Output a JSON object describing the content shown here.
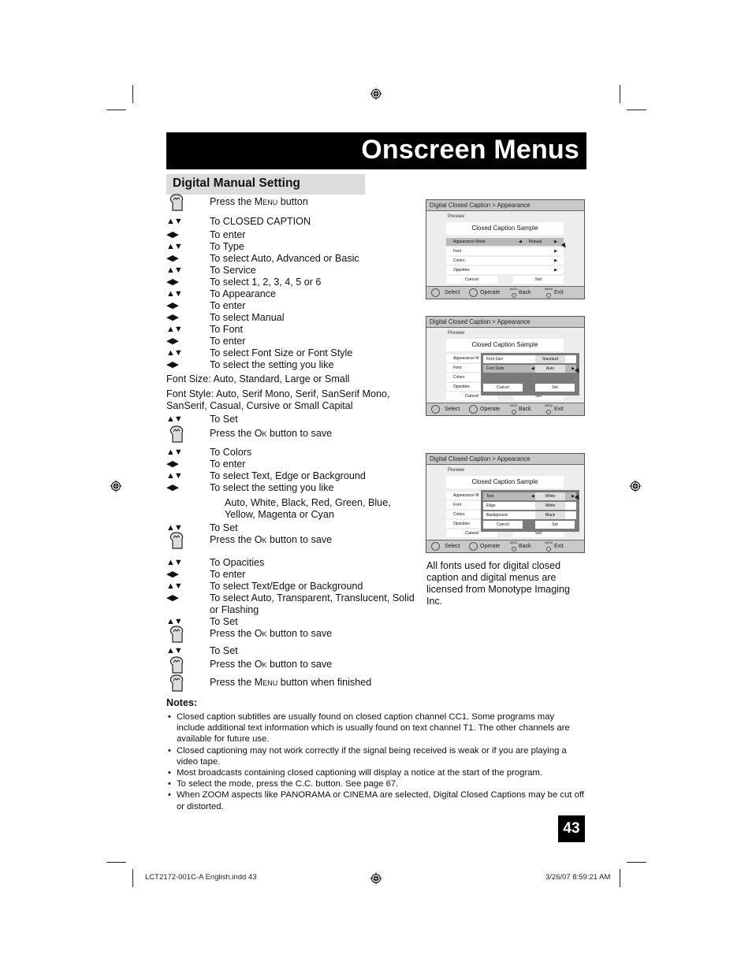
{
  "header": {
    "title": "Onscreen Menus"
  },
  "section": {
    "title": "Digital Manual Setting"
  },
  "steps": [
    {
      "icon": "hand-press-icon",
      "pre": "Press the ",
      "key": "Menu",
      "post": " button"
    },
    {
      "icon": "up-down-arrows",
      "text": "To CLOSED CAPTION"
    },
    {
      "icon": "left-right-arrows",
      "text": "To enter"
    },
    {
      "icon": "up-down-arrows",
      "text": "To Type"
    },
    {
      "icon": "left-right-arrows",
      "text": "To select Auto, Advanced or Basic"
    },
    {
      "icon": "up-down-arrows",
      "text": "To Service"
    },
    {
      "icon": "left-right-arrows",
      "text": "To select 1, 2, 3, 4, 5 or 6"
    },
    {
      "icon": "up-down-arrows",
      "text": "To Appearance"
    },
    {
      "icon": "left-right-arrows",
      "text": "To enter"
    },
    {
      "icon": "left-right-arrows",
      "text": "To select Manual"
    },
    {
      "icon": "up-down-arrows",
      "text": "To Font"
    },
    {
      "icon": "left-right-arrows",
      "text": "To enter"
    },
    {
      "icon": "up-down-arrows",
      "text": "To select Font Size or Font Style"
    },
    {
      "icon": "left-right-arrows",
      "text": "To select the setting you like"
    }
  ],
  "font_size_line": "Font Size: Auto, Standard, Large or Small",
  "font_style_line1": "Font Style: Auto, Serif Mono, Serif, SanSerif Mono,",
  "font_style_line2": "SanSerif, Casual, Cursive or Small Capital",
  "steps2": [
    {
      "icon": "up-down-arrows",
      "text": "To Set"
    },
    {
      "icon": "hand-press-icon",
      "pre": "Press the ",
      "key": "Ok",
      "post": " button to save"
    },
    {
      "icon": "up-down-arrows",
      "text": "To Colors"
    },
    {
      "icon": "left-right-arrows",
      "text": "To enter"
    },
    {
      "icon": "up-down-arrows",
      "text": "To select Text, Edge or Background"
    },
    {
      "icon": "left-right-arrows",
      "text": "To select the setting you like"
    }
  ],
  "colors_line1": "Auto, White, Black, Red, Green, Blue,",
  "colors_line2": "Yellow, Magenta or Cyan",
  "steps3": [
    {
      "icon": "up-down-arrows",
      "text": "To Set"
    },
    {
      "icon": "hand-press-icon",
      "pre": "Press the ",
      "key": "Ok",
      "post": " button to save"
    },
    {
      "icon": "up-down-arrows",
      "text": "To Opacities"
    },
    {
      "icon": "left-right-arrows",
      "text": "To enter"
    },
    {
      "icon": "up-down-arrows",
      "text": "To select Text/Edge or Background"
    },
    {
      "icon": "left-right-arrows",
      "text": "To select Auto, Transparent, Translucent, Solid or Flashing"
    },
    {
      "icon": "up-down-arrows",
      "text": "To Set"
    },
    {
      "icon": "hand-press-icon",
      "pre": "Press the ",
      "key": "Ok",
      "post": " button to save"
    },
    {
      "icon": "up-down-arrows",
      "text": "To Set"
    },
    {
      "icon": "hand-press-icon",
      "pre": "Press the ",
      "key": "Ok",
      "post": " button to save"
    },
    {
      "icon": "hand-press-icon",
      "pre": "Press the ",
      "key": "Menu",
      "post": " button when finished"
    }
  ],
  "arrows": {
    "up_down": "▲▼",
    "left_right": "◀▶"
  },
  "tv": {
    "breadcrumb": "Digital Closed Caption  >  Appearance",
    "preview": "Preview",
    "sample": "Closed Caption Sample",
    "rows": [
      "Appearance Mode",
      "Font",
      "Colors",
      "Opacities"
    ],
    "rows_short": [
      "Appearance M",
      "Font",
      "Colors",
      "Opacities"
    ],
    "mode_value": "Manual",
    "cancel": "Cancel",
    "set": "Set",
    "footer": {
      "select": "Select",
      "operate": "Operate",
      "back_tag": "BACK",
      "back": "Back",
      "menu_tag": "MENU",
      "exit": "Exit"
    },
    "font_popup": [
      {
        "label": "Font Size",
        "value": "Standard"
      },
      {
        "label": "Font Style",
        "value": "Auto"
      }
    ],
    "color_popup": [
      {
        "label": "Text",
        "value": "White"
      },
      {
        "label": "Edge",
        "value": "White"
      },
      {
        "label": "Background",
        "value": "Black"
      }
    ],
    "arrow_left": "◀",
    "arrow_right": "▶"
  },
  "side_note": "All fonts used for digital closed caption and digital menus are licensed from Monotype Imaging Inc.",
  "notes": {
    "heading": "Notes:",
    "items": [
      "Closed caption subtitles are usually found on closed caption channel CC1. Some programs may include additional text information which is usually found on text channel T1. The other channels are available for future use.",
      "Closed captioning may not work correctly if the signal being received is weak or if you are playing a video tape.",
      "Most broadcasts containing closed captioning will display a notice at the start of the program.",
      "To select the mode, press the C.C. button. See page 67.",
      "When ZOOM aspects like PANORAMA or CINEMA are selected, Digital Closed Captions may be cut off or distorted."
    ]
  },
  "page_number": "43",
  "footer": {
    "file": "LCT2172-001C-A English.indd   43",
    "timestamp": "3/26/07   8:59:21 AM"
  }
}
